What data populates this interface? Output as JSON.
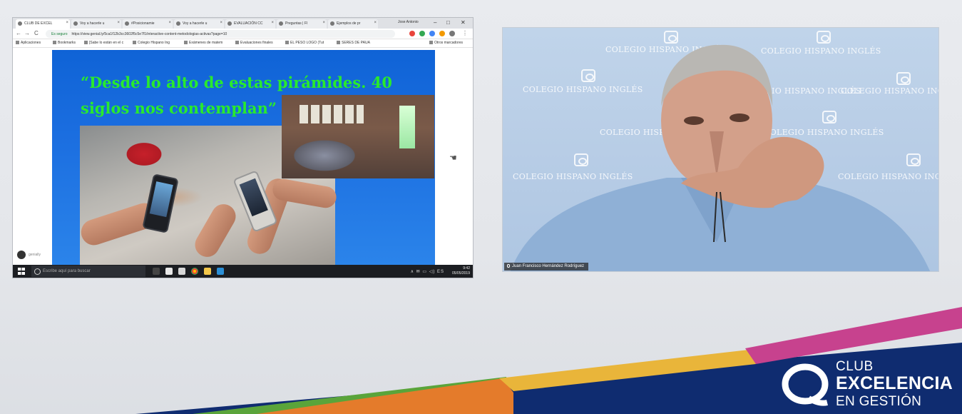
{
  "colors": {
    "slide_blue": "#1b6ee0",
    "slide_title_green": "#29ea2d",
    "brand_navy": "#0f2c70",
    "stripe_green": "#5aa43a",
    "stripe_orange": "#e47b2b",
    "stripe_yellow": "#e9b53a",
    "stripe_magenta": "#c7428e"
  },
  "browser": {
    "tabs": [
      {
        "label": "CLUB DE EXCEL",
        "active": true
      },
      {
        "label": "Voy a hacerle u"
      },
      {
        "label": "#Posicionamie"
      },
      {
        "label": "Voy a hacerle u"
      },
      {
        "label": "EVALUACIÓN CC"
      },
      {
        "label": "Preguntas | Fl"
      },
      {
        "label": "Ejemplos de pr"
      }
    ],
    "profile": "Jose Antonio",
    "window_controls": {
      "minimize": "–",
      "maximize": "□",
      "close": "✕"
    },
    "address": {
      "secure_label": "Es seguro",
      "url": "https://view.genial.ly/5ca1f12b3cc3602f5c5e7f1/interactive-content-metodologias-activas?page=10"
    },
    "bookmarks": [
      "Aplicaciones",
      "Bookmarks",
      "[Sabe lo están en el c",
      "Colegio Hispano Ing",
      "Exámenes de matem",
      "Evaluaciones finales",
      "EL PESO LOGO (Tut",
      "SERES DE PAUA",
      "Otros marcadores"
    ],
    "nav": {
      "back": "←",
      "forward": "→",
      "reload": "C",
      "secure_lock": "🔒"
    }
  },
  "slide": {
    "title": "“Desde lo alto de estas pirámides. 40 siglos nos contemplan”",
    "footer_logo": "genially"
  },
  "taskbar": {
    "search_placeholder": "Escribe aquí para buscar",
    "tray": "∧ ✉ ▭ ◁) ES",
    "time": "9:42",
    "date": "05/05/2019"
  },
  "webcam": {
    "watermark": "COLEGIO HISPANO INGLÉS",
    "participant_name": "Juan Francisco Hernández Rodríguez"
  },
  "brand": {
    "line1": "CLUB",
    "line2": "EXCELENCIA",
    "line3": "EN GESTIÓN"
  }
}
